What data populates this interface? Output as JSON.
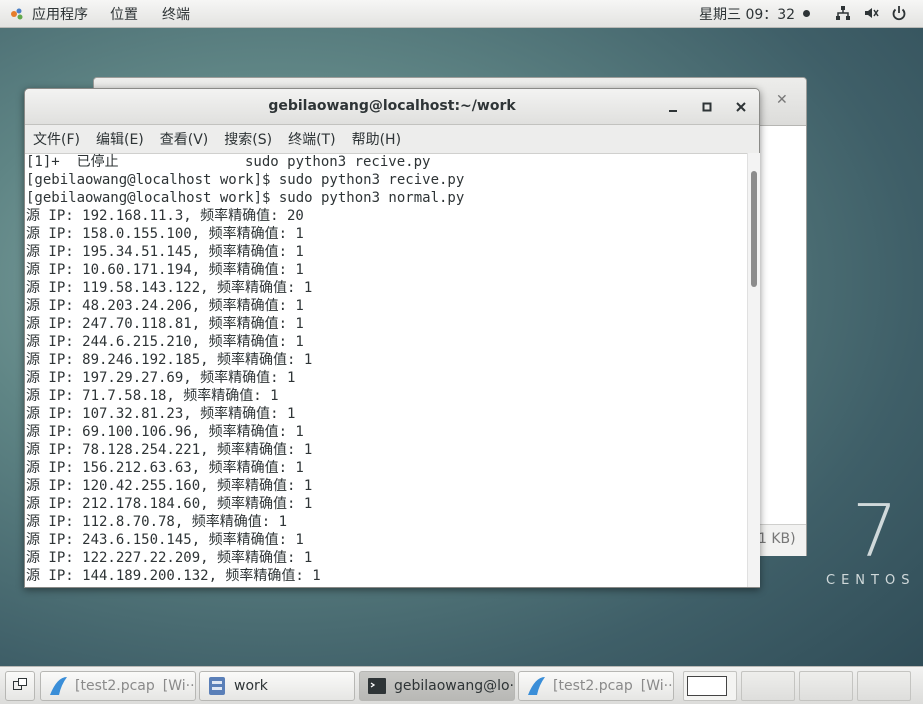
{
  "topbar": {
    "menus": [
      "应用程序",
      "位置",
      "终端"
    ],
    "clock": "星期三 09：32"
  },
  "bg_window": {
    "close_glyph": "✕",
    "status_size": "1 KB)"
  },
  "centos": {
    "seven": "7",
    "word": "CENTOS"
  },
  "terminal": {
    "title": "gebilaowang@localhost:~/work",
    "menus": [
      "文件(F)",
      "编辑(E)",
      "查看(V)",
      "搜索(S)",
      "终端(T)",
      "帮助(H)"
    ],
    "lines": [
      "[1]+  已停止               sudo python3 recive.py",
      "[gebilaowang@localhost work]$ sudo python3 recive.py",
      "[gebilaowang@localhost work]$ sudo python3 normal.py",
      "源 IP: 192.168.11.3, 频率精确值: 20",
      "源 IP: 158.0.155.100, 频率精确值: 1",
      "源 IP: 195.34.51.145, 频率精确值: 1",
      "源 IP: 10.60.171.194, 频率精确值: 1",
      "源 IP: 119.58.143.122, 频率精确值: 1",
      "源 IP: 48.203.24.206, 频率精确值: 1",
      "源 IP: 247.70.118.81, 频率精确值: 1",
      "源 IP: 244.6.215.210, 频率精确值: 1",
      "源 IP: 89.246.192.185, 频率精确值: 1",
      "源 IP: 197.29.27.69, 频率精确值: 1",
      "源 IP: 71.7.58.18, 频率精确值: 1",
      "源 IP: 107.32.81.23, 频率精确值: 1",
      "源 IP: 69.100.106.96, 频率精确值: 1",
      "源 IP: 78.128.254.221, 频率精确值: 1",
      "源 IP: 156.212.63.63, 频率精确值: 1",
      "源 IP: 120.42.255.160, 频率精确值: 1",
      "源 IP: 212.178.184.60, 频率精确值: 1",
      "源 IP: 112.8.70.78, 频率精确值: 1",
      "源 IP: 243.6.150.145, 频率精确值: 1",
      "源 IP: 122.227.22.209, 频率精确值: 1",
      "源 IP: 144.189.200.132, 频率精确值: 1"
    ]
  },
  "taskbar": {
    "tasks": [
      {
        "label": "[test2.pcap",
        "suffix": "[Wi···",
        "icon": "wireshark-icon"
      },
      {
        "label": "work",
        "suffix": "",
        "icon": "file-manager-icon"
      },
      {
        "label": "gebilaowang@lo···",
        "suffix": "",
        "icon": "terminal-icon"
      },
      {
        "label": "[test2.pcap",
        "suffix": "[Wi···",
        "icon": "wireshark-icon"
      }
    ]
  },
  "colors": {
    "accent": "#2e3436",
    "desktop": "#5f8585"
  }
}
